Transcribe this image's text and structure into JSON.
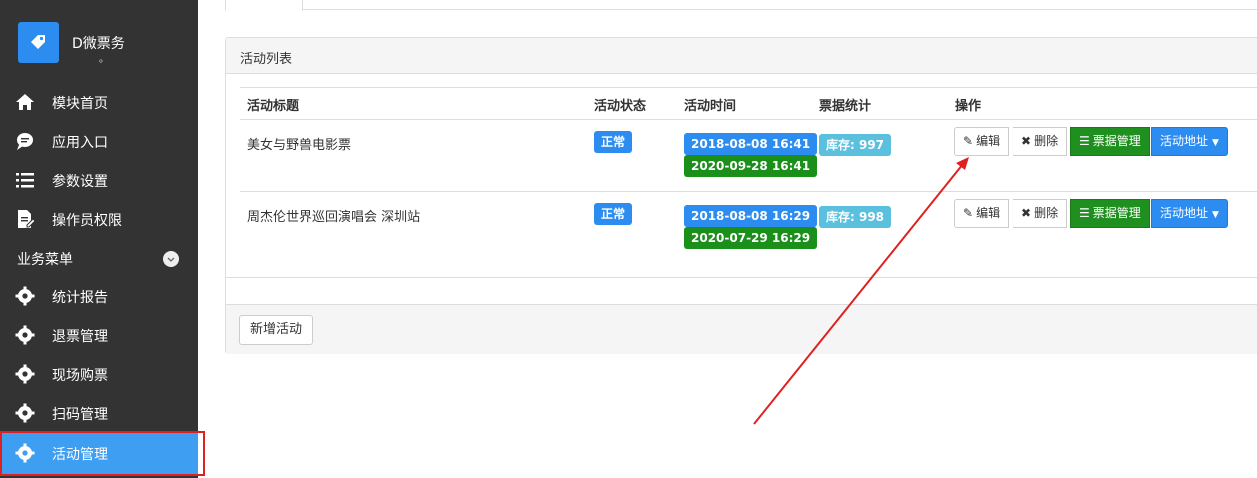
{
  "brand": {
    "name": "D微票务",
    "sub": "。"
  },
  "nav": {
    "items": [
      {
        "label": "模块首页",
        "icon": "home-icon"
      },
      {
        "label": "应用入口",
        "icon": "chat-icon"
      },
      {
        "label": "参数设置",
        "icon": "list-icon"
      },
      {
        "label": "操作员权限",
        "icon": "edit-doc-icon"
      }
    ],
    "section": "业务菜单",
    "biz_items": [
      {
        "label": "统计报告",
        "icon": "gear-icon"
      },
      {
        "label": "退票管理",
        "icon": "gear-icon"
      },
      {
        "label": "现场购票",
        "icon": "gear-icon"
      },
      {
        "label": "扫码管理",
        "icon": "gear-icon"
      },
      {
        "label": "活动管理",
        "icon": "gear-icon",
        "active": true
      }
    ]
  },
  "panel": {
    "title": "活动列表",
    "columns": [
      "活动标题",
      "活动状态",
      "活动时间",
      "票据统计",
      "操作"
    ],
    "rows": [
      {
        "title": "美女与野兽电影票",
        "status": "正常",
        "start": "2018-08-08 16:41",
        "end": "2020-09-28 16:41",
        "stock": "库存: 997"
      },
      {
        "title": "周杰伦世界巡回演唱会 深圳站",
        "status": "正常",
        "start": "2018-08-08 16:29",
        "end": "2020-07-29 16:29",
        "stock": "库存: 998"
      }
    ],
    "actions": {
      "edit": "编辑",
      "delete": "删除",
      "tickets": "票据管理",
      "address": "活动地址"
    },
    "add_button": "新增活动"
  },
  "colors": {
    "sidebar": "#333333",
    "accent": "#2d8cf0",
    "success": "#1f8f1f",
    "info": "#5bc0de",
    "highlight": "#e02020"
  }
}
